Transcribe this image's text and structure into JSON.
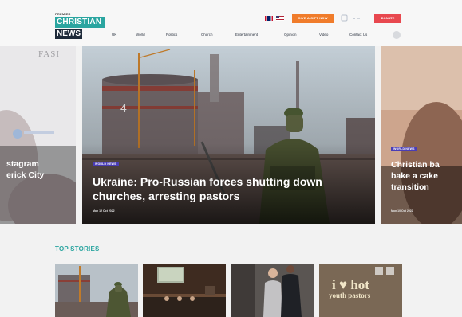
{
  "header": {
    "logo": {
      "line_top": "PREMIER",
      "line_mid": "CHRISTIAN",
      "line_bottom": "NEWS"
    },
    "give_button": "GIVE A GIFT NOW",
    "donate_button": "DONATE",
    "nav": [
      "UK",
      "World",
      "Politics",
      "Church",
      "Entertainment",
      "Opinion",
      "Video",
      "Contact Us"
    ]
  },
  "slider": {
    "left": {
      "faded_text": "FASI",
      "title_line1": "stagram",
      "title_line2": "erick City"
    },
    "main": {
      "badge": "WORLD NEWS",
      "title": "Ukraine: Pro-Russian forces shutting down churches, arresting pastors",
      "date": "Mon 12 Oct 2022"
    },
    "right": {
      "badge": "WORLD NEWS",
      "title_line1": "Christian ba",
      "title_line2": "bake a cake",
      "title_line3": "transition",
      "date": "Mon 10 Oct 2022"
    }
  },
  "top_stories": {
    "heading": "TOP STORIES",
    "thumb4_text_line1": "i ♥ hot",
    "thumb4_text_line2": "youth pastors"
  },
  "colors": {
    "brand_teal": "#2aa5a0",
    "navy": "#1e2a3a",
    "orange": "#f07c2b",
    "red": "#e8484f",
    "badge_purple": "#4a3db5"
  },
  "icons": [
    "flag-uk-icon",
    "flag-us-icon",
    "search-icon",
    "settings-icon"
  ]
}
